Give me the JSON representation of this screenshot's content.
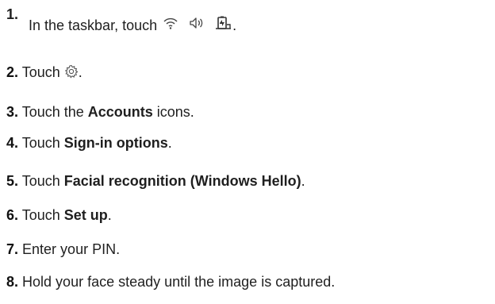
{
  "steps": [
    {
      "number": "1.",
      "before": "In the taskbar, touch ",
      "icons": [
        "wifi-icon",
        "speaker-icon",
        "battery-icon"
      ],
      "after": "."
    },
    {
      "number": "2.",
      "before": "Touch ",
      "icons": [
        "gear-icon"
      ],
      "after": "."
    },
    {
      "number": "3.",
      "before": "Touch the ",
      "bold": "Accounts",
      "after": " icons."
    },
    {
      "number": "4.",
      "before": "Touch ",
      "bold": "Sign-in options",
      "after": "."
    },
    {
      "number": "5.",
      "before": "Touch ",
      "bold": "Facial recognition (Windows Hello)",
      "after": "."
    },
    {
      "number": "6.",
      "before": "Touch ",
      "bold": "Set up",
      "after": "."
    },
    {
      "number": "7.",
      "before": "Enter your PIN.",
      "after": ""
    },
    {
      "number": "8.",
      "before": "Hold your face steady until the image is captured.",
      "after": ""
    }
  ]
}
